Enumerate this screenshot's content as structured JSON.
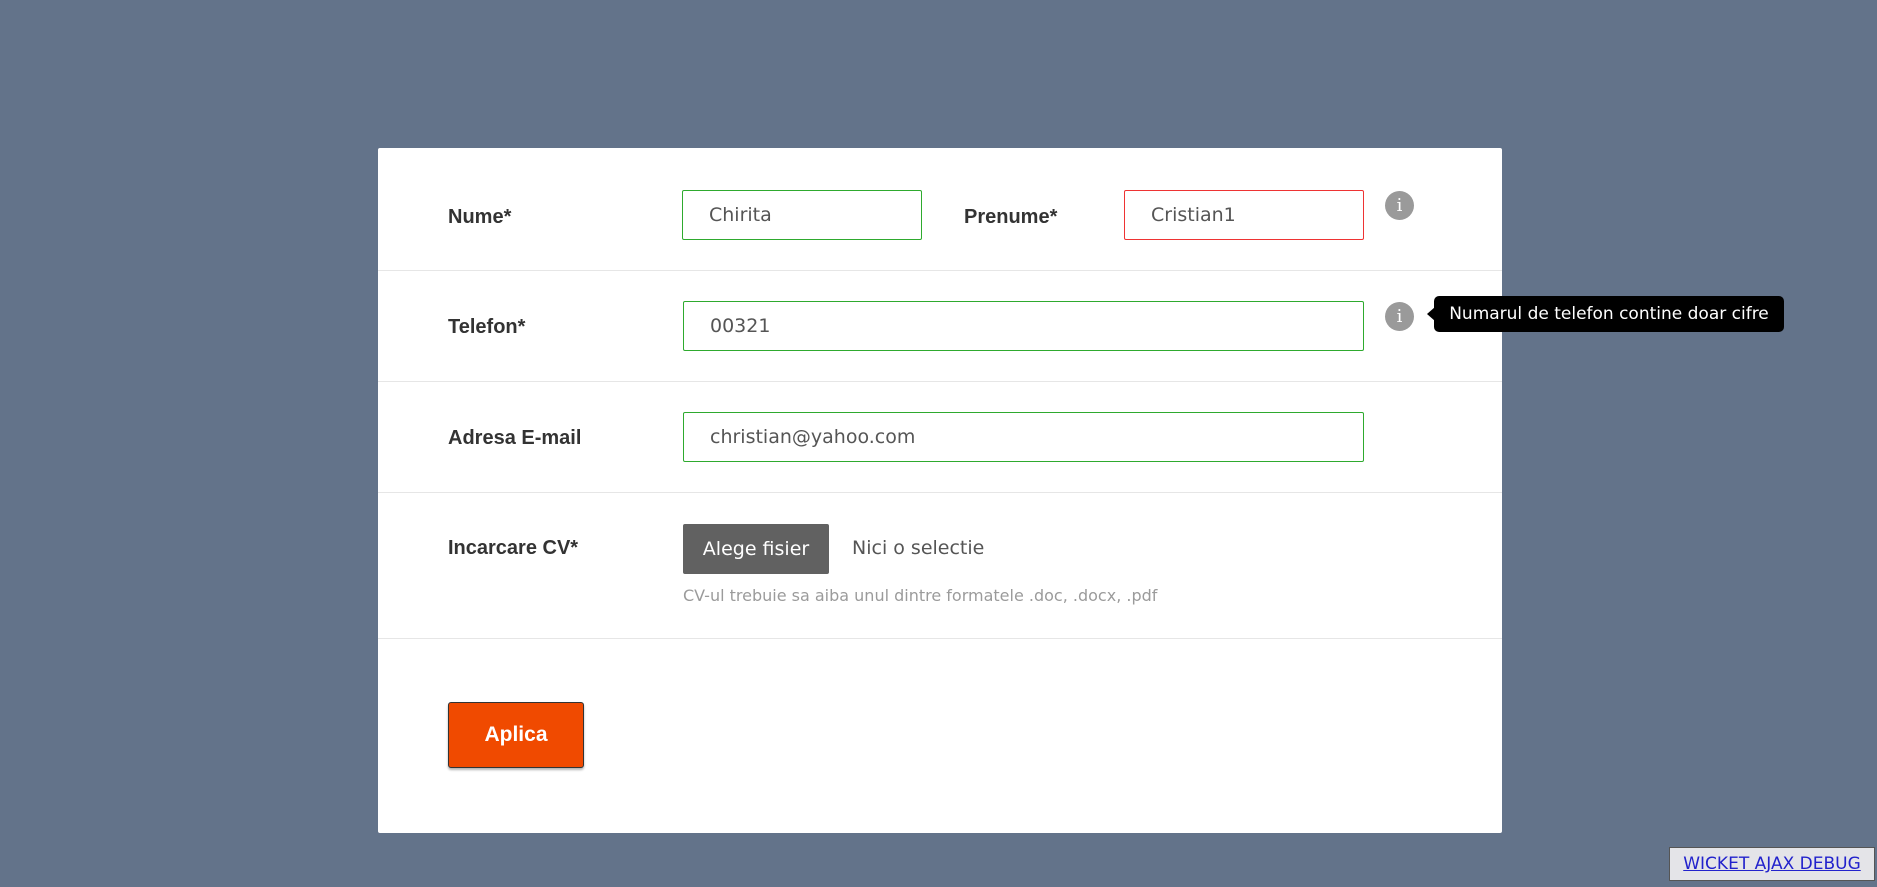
{
  "form": {
    "nume": {
      "label": "Nume*",
      "value": "Chirita"
    },
    "prenume": {
      "label": "Prenume*",
      "value": "Cristian1"
    },
    "telefon": {
      "label": "Telefon*",
      "value": "00321"
    },
    "email": {
      "label": "Adresa E-mail",
      "value": "christian@yahoo.com"
    },
    "cv": {
      "label": "Incarcare CV*",
      "button_label": "Alege fisier",
      "status": "Nici o selectie",
      "hint": "CV-ul trebuie sa aiba unul dintre formatele .doc, .docx, .pdf"
    },
    "submit_label": "Aplica"
  },
  "info_icon_glyph": "i",
  "tooltip": {
    "text": "Numarul de telefon contine doar cifre"
  },
  "debug_link": "WICKET AJAX DEBUG",
  "colors": {
    "background": "#63738a",
    "valid_border": "#2eaa2e",
    "error_border": "#ee3333",
    "accent": "#f04a00"
  }
}
